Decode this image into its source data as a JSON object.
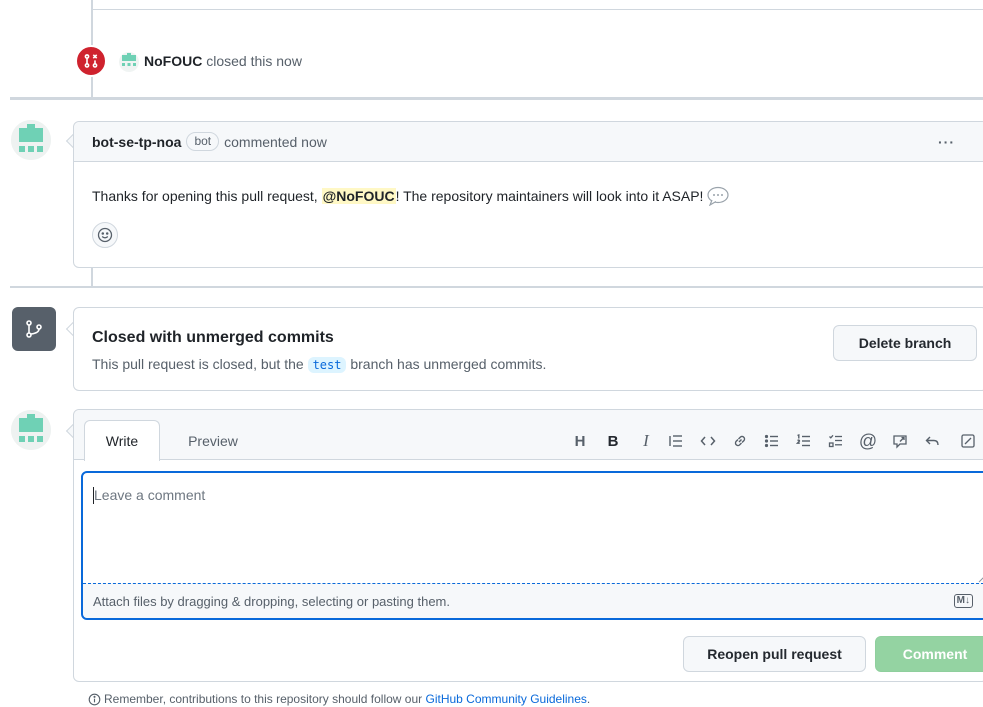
{
  "closed_event": {
    "actor": "NoFOUC",
    "action": "closed this now"
  },
  "bot_comment": {
    "author": "bot-se-tp-noa",
    "badge": "bot",
    "action": "commented now",
    "menu": "···",
    "body_before": "Thanks for opening this pull request, ",
    "mention": "@NoFOUC",
    "body_after": "! The repository maintainers will look into it ASAP! "
  },
  "merge_status": {
    "title": "Closed with unmerged commits",
    "desc_before": "This pull request is closed, but the ",
    "branch": "test",
    "desc_after": " branch has unmerged commits.",
    "delete_branch_label": "Delete branch"
  },
  "editor": {
    "tabs": [
      "Write",
      "Preview"
    ],
    "toolbar": [
      "heading-icon",
      "bold-icon",
      "italic-icon",
      "quote-icon",
      "code-icon",
      "link-icon",
      "unordered-list-icon",
      "ordered-list-icon",
      "task-list-icon",
      "mention-icon",
      "reference-icon",
      "reply-icon",
      "fullscreen-icon"
    ],
    "placeholder": "Leave a comment",
    "attach_hint": "Attach files by dragging & dropping, selecting or pasting them.",
    "markdown_badge": "M↓"
  },
  "actions": {
    "reopen_label": "Reopen pull request",
    "comment_label": "Comment"
  },
  "footer": {
    "note_before": "Remember, contributions to this repository should follow our ",
    "link": "GitHub Community Guidelines",
    "note_after": "."
  },
  "colors": {
    "closed_red": "#cf222e",
    "accent_blue": "#0969da",
    "disabled_green": "#94d3a2",
    "mention_yellow": "#fff8c5"
  }
}
